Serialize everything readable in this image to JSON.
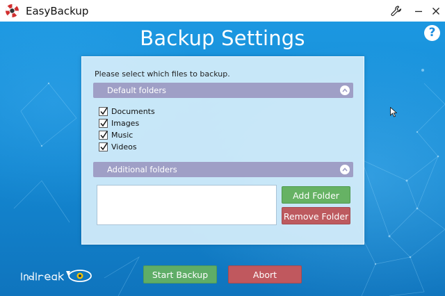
{
  "window": {
    "title": "EasyBackup",
    "logo_icon": "lifebuoy-icon",
    "controls": [
      "wrench-icon",
      "minimize-icon",
      "close-icon"
    ]
  },
  "page": {
    "title": "Backup Settings",
    "help_label": "?"
  },
  "panel": {
    "instruction": "Please select which files to backup.",
    "default_section": {
      "label": "Default folders",
      "expanded": true,
      "items": [
        {
          "label": "Documents",
          "checked": true
        },
        {
          "label": "Images",
          "checked": true
        },
        {
          "label": "Music",
          "checked": true
        },
        {
          "label": "Videos",
          "checked": true
        }
      ]
    },
    "additional_section": {
      "label": "Additional folders",
      "expanded": true,
      "folders": []
    },
    "add_folder_label": "Add Folder",
    "remove_folder_label": "Remove Folder"
  },
  "footer": {
    "start_label": "Start Backup",
    "abort_label": "Abort"
  },
  "colors": {
    "background": "#1a8fd6",
    "panel": "#d2ecfa",
    "section_header": "#9f9fc6",
    "success": "#66b264",
    "danger": "#bd5a5f"
  }
}
